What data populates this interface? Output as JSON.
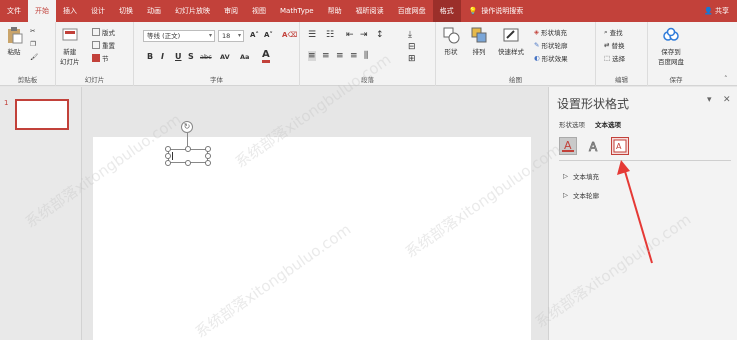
{
  "menubar": {
    "tabs": [
      "文件",
      "开始",
      "插入",
      "设计",
      "切换",
      "动画",
      "幻灯片放映",
      "审阅",
      "视图",
      "MathType",
      "帮助",
      "福昕阅读",
      "百度网盘",
      "格式"
    ],
    "help_label": "操作说明搜索",
    "share_label": "共享"
  },
  "ribbon": {
    "clipboard": {
      "paste": "粘贴",
      "label": "剪贴板"
    },
    "slides": {
      "new_slide": "新建",
      "new_slide2": "幻灯片",
      "layout": "版式",
      "reset": "重置",
      "section": "节",
      "label": "幻灯片"
    },
    "font": {
      "font_name": "等线 (正文)",
      "font_size": "18",
      "bold": "B",
      "italic": "I",
      "underline": "U",
      "shadow": "S",
      "strike": "abc",
      "spacing": "AV",
      "case": "Aa",
      "label": "字体"
    },
    "paragraph": {
      "label": "段落"
    },
    "drawing": {
      "shape": "形状",
      "arrange": "排列",
      "quick_style": "快速样式",
      "fill": "形状填充",
      "outline": "形状轮廓",
      "effects": "形状效果",
      "label": "绘图"
    },
    "editing": {
      "find": "查找",
      "replace": "替换",
      "select": "选择",
      "label": "编辑"
    },
    "save": {
      "save_to": "保存到",
      "baidu": "百度网盘",
      "label": "保存"
    }
  },
  "thumbs": {
    "slide_num": "1"
  },
  "panel": {
    "title": "设置形状格式",
    "tab_shape": "形状选项",
    "tab_text": "文本选项",
    "section_fill": "文本填充",
    "section_outline": "文本轮廓"
  },
  "watermark": "系统部落xitongbuluo.com",
  "colors": {
    "accent": "#c2413a",
    "arrow": "#e53935"
  }
}
